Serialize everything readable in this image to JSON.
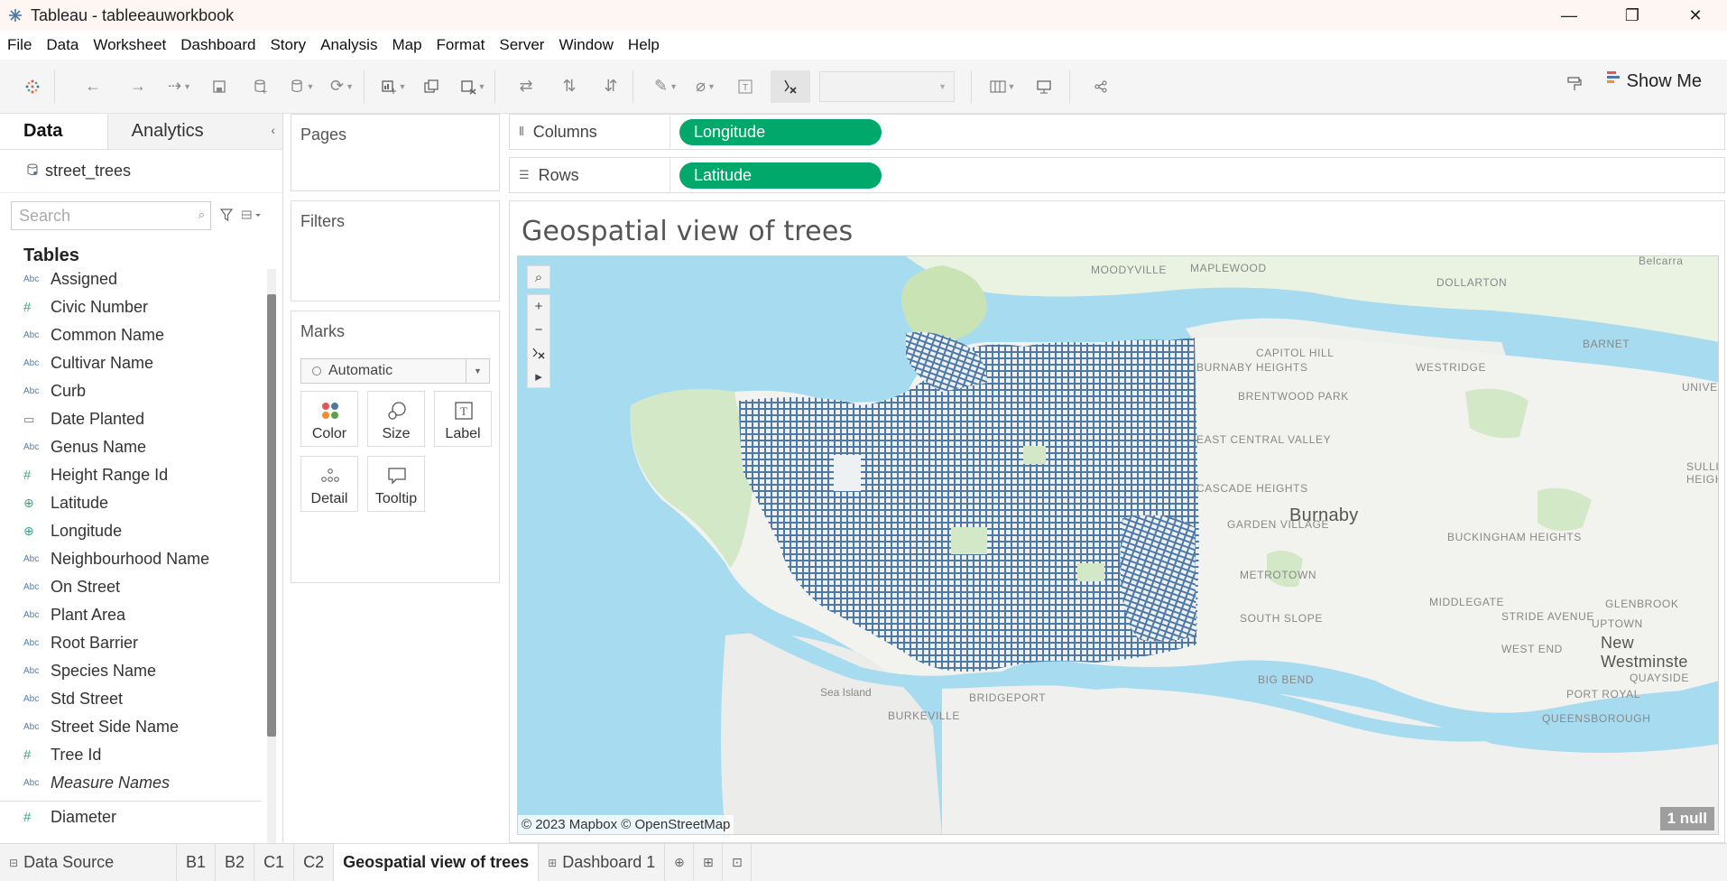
{
  "window": {
    "title": "Tableau - tableeauworkbook",
    "minimize_glyph": "—",
    "restore_glyph": "❐",
    "close_glyph": "✕"
  },
  "menu": [
    "File",
    "Data",
    "Worksheet",
    "Dashboard",
    "Story",
    "Analysis",
    "Map",
    "Format",
    "Server",
    "Window",
    "Help"
  ],
  "toolbar": {
    "show_me_label": "Show Me"
  },
  "data_pane": {
    "tabs": [
      "Data",
      "Analytics"
    ],
    "datasource": "street_trees",
    "search_placeholder": "Search",
    "tables_heading": "Tables",
    "fields": [
      {
        "type": "Abc",
        "label": "Assigned"
      },
      {
        "type": "#",
        "label": "Civic Number"
      },
      {
        "type": "Abc",
        "label": "Common Name"
      },
      {
        "type": "Abc",
        "label": "Cultivar Name"
      },
      {
        "type": "Abc",
        "label": "Curb"
      },
      {
        "type": "date",
        "label": "Date Planted"
      },
      {
        "type": "Abc",
        "label": "Genus Name"
      },
      {
        "type": "#",
        "label": "Height Range Id"
      },
      {
        "type": "geo",
        "label": "Latitude"
      },
      {
        "type": "geo",
        "label": "Longitude"
      },
      {
        "type": "Abc",
        "label": "Neighbourhood Name"
      },
      {
        "type": "Abc",
        "label": "On Street"
      },
      {
        "type": "Abc",
        "label": "Plant Area"
      },
      {
        "type": "Abc",
        "label": "Root Barrier"
      },
      {
        "type": "Abc",
        "label": "Species Name"
      },
      {
        "type": "Abc",
        "label": "Std Street"
      },
      {
        "type": "Abc",
        "label": "Street Side Name"
      },
      {
        "type": "#",
        "label": "Tree Id"
      },
      {
        "type": "Abc",
        "label": "Measure Names"
      }
    ],
    "measures": [
      {
        "type": "#",
        "label": "Diameter"
      }
    ]
  },
  "cards": {
    "pages": "Pages",
    "filters": "Filters",
    "marks": "Marks",
    "marks_type": "Automatic",
    "mark_buttons": [
      "Color",
      "Size",
      "Label",
      "Detail",
      "Tooltip"
    ]
  },
  "shelves": {
    "columns_label": "Columns",
    "columns_pill": "Longitude",
    "rows_label": "Rows",
    "rows_pill": "Latitude",
    "pill_color": "#00a86b"
  },
  "viz": {
    "title": "Geospatial view of trees",
    "attribution": "© 2023 Mapbox © OpenStreetMap",
    "null_indicator": "1 null",
    "mark_color": "#4e79a7",
    "water_color": "#a6dbf0",
    "land_color": "#f2f2ef",
    "park_color": "#d3e8c6",
    "places": [
      "MOODYVILLE",
      "MAPLEWOOD",
      "Belcarra",
      "DOLLARTON",
      "BARNET",
      "CAPITOL HILL",
      "WESTRIDGE",
      "BURNABY HEIGHTS",
      "BRENTWOOD PARK",
      "UNIVERCI",
      "EAST CENTRAL VALLEY",
      "SULLI HEIGH",
      "CASCADE HEIGHTS",
      "Burnaby",
      "GARDEN VILLAGE",
      "BUCKINGHAM HEIGHTS",
      "METROTOWN",
      "MIDDLEGATE",
      "GLENBROOK",
      "SOUTH SLOPE",
      "STRIDE AVENUE",
      "UPTOWN",
      "WEST END",
      "New Westminste",
      "QUAYSIDE",
      "BIG BEND",
      "PORT ROYAL",
      "QUEENSBOROUGH",
      "BRIDGEPORT",
      "BURKEVILLE",
      "Sea Island"
    ]
  },
  "bottom_tabs": [
    "Data Source",
    "B1",
    "B2",
    "C1",
    "C2",
    "Geospatial view of trees",
    "Dashboard 1"
  ],
  "active_tab": "Geospatial view of trees"
}
